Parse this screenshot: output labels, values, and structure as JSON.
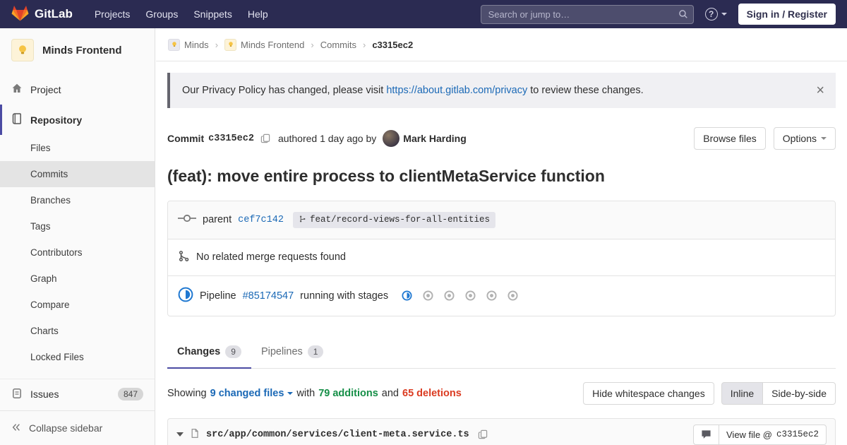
{
  "navbar": {
    "brand": "GitLab",
    "menu": [
      "Projects",
      "Groups",
      "Snippets",
      "Help"
    ],
    "search_placeholder": "Search or jump to…",
    "sign_in": "Sign in / Register"
  },
  "sidebar": {
    "project_name": "Minds Frontend",
    "project": "Project",
    "repository": "Repository",
    "repo_items": [
      "Files",
      "Commits",
      "Branches",
      "Tags",
      "Contributors",
      "Graph",
      "Compare",
      "Charts",
      "Locked Files"
    ],
    "issues": "Issues",
    "issues_count": "847",
    "collapse": "Collapse sidebar"
  },
  "breadcrumb": {
    "items": [
      "Minds",
      "Minds Frontend",
      "Commits"
    ],
    "current": "c3315ec2"
  },
  "banner": {
    "text_before": "Our Privacy Policy has changed, please visit ",
    "link": "https://about.gitlab.com/privacy",
    "text_after": " to review these changes.",
    "close": "×"
  },
  "commit": {
    "label": "Commit",
    "sha": "c3315ec2",
    "authored": "authored 1 day ago by",
    "author": "Mark Harding",
    "browse_files": "Browse files",
    "options": "Options",
    "title": "(feat): move entire process to clientMetaService function",
    "parent_label": "parent",
    "parent_sha": "cef7c142",
    "branch": "feat/record-views-for-all-entities",
    "no_merge_requests": "No related merge requests found",
    "pipeline_label": "Pipeline",
    "pipeline_id": "#85174547",
    "pipeline_suffix": "running with stages"
  },
  "tabs": {
    "changes": "Changes",
    "changes_count": "9",
    "pipelines": "Pipelines",
    "pipelines_count": "1"
  },
  "toolbar": {
    "showing": "Showing",
    "changed_files": "9 changed files",
    "with": "with",
    "additions": "79 additions",
    "and": "and",
    "deletions": "65 deletions",
    "hide_whitespace": "Hide whitespace changes",
    "inline": "Inline",
    "side_by_side": "Side-by-side"
  },
  "file": {
    "path": "src/app/common/services/client-meta.service.ts",
    "view_file_prefix": "View file @",
    "view_file_sha": "c3315ec2"
  },
  "colors": {
    "navbar_bg": "#2b2b52",
    "accent_indigo": "#4b4ba3",
    "link_blue": "#1b69b6",
    "additions_green": "#168f48",
    "deletions_red": "#db3b21",
    "running_blue": "#1f78d1"
  }
}
